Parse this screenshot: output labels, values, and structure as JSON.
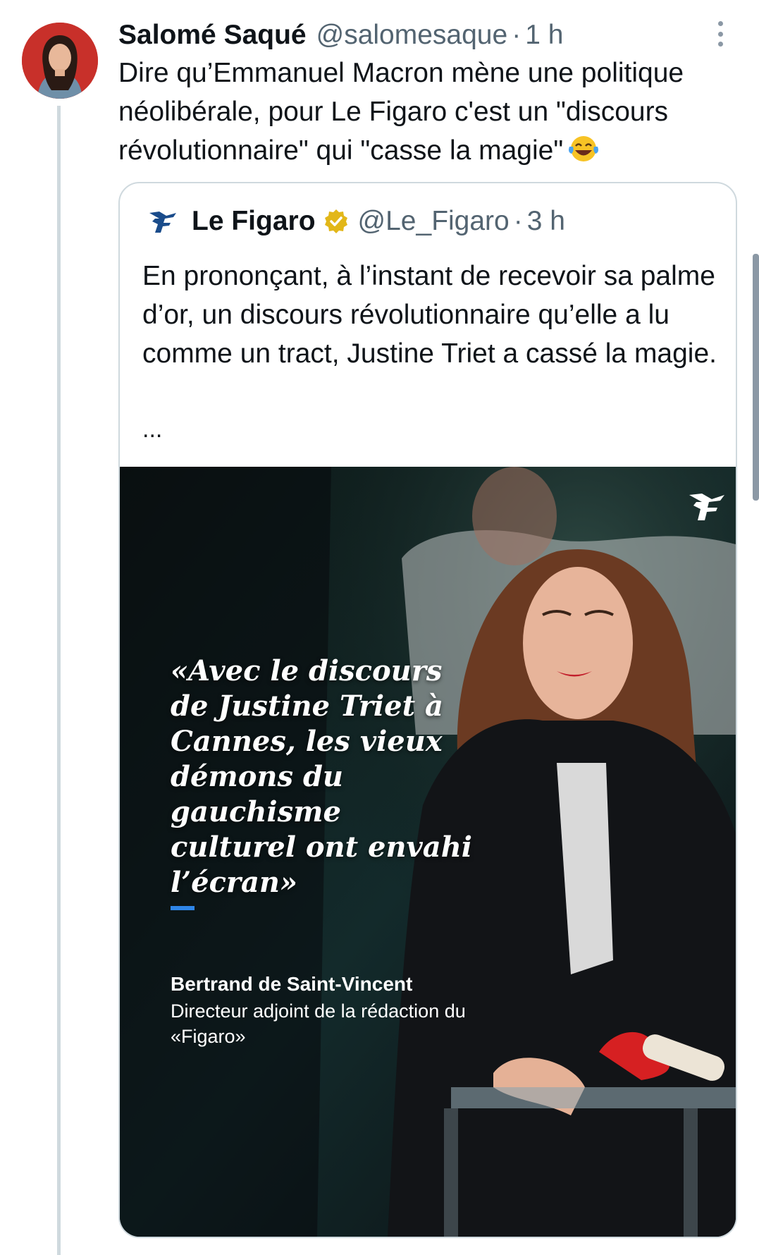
{
  "tweet": {
    "author_name": "Salomé Saqué",
    "author_handle": "@salomesaque",
    "separator": "·",
    "time": "1 h",
    "text": "Dire qu’Emmanuel Macron mène une politique néolibérale, pour Le Figaro c'est un \"discours révolutionnaire\" qui \"casse la magie\"",
    "emoji": "face-with-tears-of-joy"
  },
  "quoted": {
    "author_name": "Le Figaro",
    "author_handle": "@Le_Figaro",
    "separator": "·",
    "time": "3 h",
    "verified_badge_color": "#e2b719",
    "text": "En prononçant, à l’instant de recevoir sa palme d’or, un discours révolutionnaire qu’elle a lu comme un tract, Justine Triet a cassé la magie.",
    "ellipsis": "...",
    "media": {
      "quote": "«Avec le discours de Justine Triet à Cannes, les vieux démons du gauchisme culturel ont envahi l’écran»",
      "author": "Bertrand de Saint-Vincent",
      "role": "Directeur adjoint de la rédaction du «Figaro»",
      "accent_color": "#2f86e8"
    }
  }
}
